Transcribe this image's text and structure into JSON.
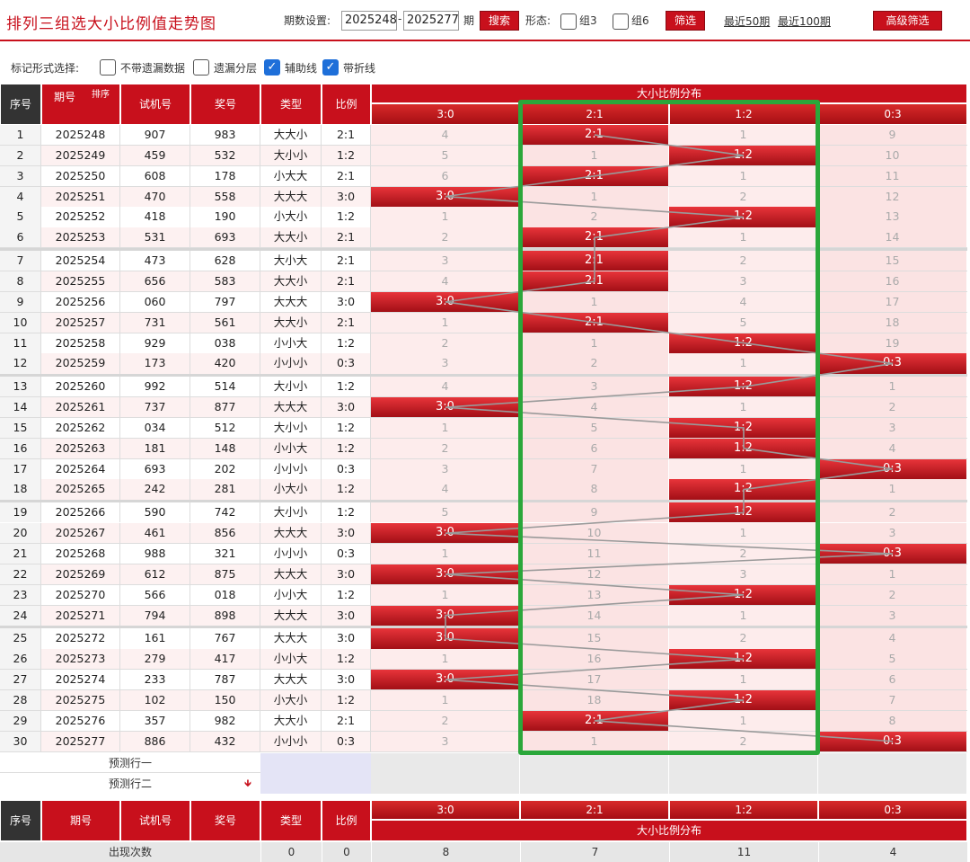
{
  "header": {
    "title": "排列三组选大小比例值走势图",
    "period_label": "期数设置:",
    "period_from": "2025248",
    "dash": "-",
    "period_to": "2025277",
    "period_unit": "期",
    "search_btn": "搜索",
    "form_label": "形态:",
    "group3": "组3",
    "group6": "组6",
    "filter_btn": "筛选",
    "recent50": "最近50期",
    "recent100": "最近100期",
    "advanced_btn": "高级筛选"
  },
  "options": {
    "label": "标记形式选择:",
    "items": [
      {
        "label": "不带遗漏数据",
        "checked": false
      },
      {
        "label": "遗漏分层",
        "checked": false
      },
      {
        "label": "辅助线",
        "checked": true
      },
      {
        "label": "带折线",
        "checked": true
      }
    ]
  },
  "table": {
    "headers": {
      "seq": "序号",
      "issue": "期号",
      "sort": "排序",
      "trial": "试机号",
      "award": "奖号",
      "type": "类型",
      "ratio": "比例",
      "dist": "大小比例分布"
    },
    "dist_columns": [
      "3:0",
      "2:1",
      "1:2",
      "0:3"
    ],
    "rows": [
      {
        "seq": "1",
        "issue": "2025248",
        "trial": "907",
        "award": "983",
        "type": "大大小",
        "ratio": "2:1",
        "cells": [
          "4",
          "2:1",
          "1",
          "9"
        ],
        "hit": 1
      },
      {
        "seq": "2",
        "issue": "2025249",
        "trial": "459",
        "award": "532",
        "type": "大小小",
        "ratio": "1:2",
        "cells": [
          "5",
          "1",
          "1:2",
          "10"
        ],
        "hit": 2
      },
      {
        "seq": "3",
        "issue": "2025250",
        "trial": "608",
        "award": "178",
        "type": "小大大",
        "ratio": "2:1",
        "cells": [
          "6",
          "2:1",
          "1",
          "11"
        ],
        "hit": 1
      },
      {
        "seq": "4",
        "issue": "2025251",
        "trial": "470",
        "award": "558",
        "type": "大大大",
        "ratio": "3:0",
        "cells": [
          "3:0",
          "1",
          "2",
          "12"
        ],
        "hit": 0
      },
      {
        "seq": "5",
        "issue": "2025252",
        "trial": "418",
        "award": "190",
        "type": "小大小",
        "ratio": "1:2",
        "cells": [
          "1",
          "2",
          "1:2",
          "13"
        ],
        "hit": 2
      },
      {
        "seq": "6",
        "issue": "2025253",
        "trial": "531",
        "award": "693",
        "type": "大大小",
        "ratio": "2:1",
        "cells": [
          "2",
          "2:1",
          "1",
          "14"
        ],
        "hit": 1
      },
      {
        "seq": "7",
        "issue": "2025254",
        "trial": "473",
        "award": "628",
        "type": "大小大",
        "ratio": "2:1",
        "cells": [
          "3",
          "2:1",
          "2",
          "15"
        ],
        "hit": 1
      },
      {
        "seq": "8",
        "issue": "2025255",
        "trial": "656",
        "award": "583",
        "type": "大大小",
        "ratio": "2:1",
        "cells": [
          "4",
          "2:1",
          "3",
          "16"
        ],
        "hit": 1
      },
      {
        "seq": "9",
        "issue": "2025256",
        "trial": "060",
        "award": "797",
        "type": "大大大",
        "ratio": "3:0",
        "cells": [
          "3:0",
          "1",
          "4",
          "17"
        ],
        "hit": 0
      },
      {
        "seq": "10",
        "issue": "2025257",
        "trial": "731",
        "award": "561",
        "type": "大大小",
        "ratio": "2:1",
        "cells": [
          "1",
          "2:1",
          "5",
          "18"
        ],
        "hit": 1
      },
      {
        "seq": "11",
        "issue": "2025258",
        "trial": "929",
        "award": "038",
        "type": "小小大",
        "ratio": "1:2",
        "cells": [
          "2",
          "1",
          "1:2",
          "19"
        ],
        "hit": 2
      },
      {
        "seq": "12",
        "issue": "2025259",
        "trial": "173",
        "award": "420",
        "type": "小小小",
        "ratio": "0:3",
        "cells": [
          "3",
          "2",
          "1",
          "0:3"
        ],
        "hit": 3
      },
      {
        "seq": "13",
        "issue": "2025260",
        "trial": "992",
        "award": "514",
        "type": "大小小",
        "ratio": "1:2",
        "cells": [
          "4",
          "3",
          "1:2",
          "1"
        ],
        "hit": 2
      },
      {
        "seq": "14",
        "issue": "2025261",
        "trial": "737",
        "award": "877",
        "type": "大大大",
        "ratio": "3:0",
        "cells": [
          "3:0",
          "4",
          "1",
          "2"
        ],
        "hit": 0
      },
      {
        "seq": "15",
        "issue": "2025262",
        "trial": "034",
        "award": "512",
        "type": "大小小",
        "ratio": "1:2",
        "cells": [
          "1",
          "5",
          "1:2",
          "3"
        ],
        "hit": 2
      },
      {
        "seq": "16",
        "issue": "2025263",
        "trial": "181",
        "award": "148",
        "type": "小小大",
        "ratio": "1:2",
        "cells": [
          "2",
          "6",
          "1:2",
          "4"
        ],
        "hit": 2
      },
      {
        "seq": "17",
        "issue": "2025264",
        "trial": "693",
        "award": "202",
        "type": "小小小",
        "ratio": "0:3",
        "cells": [
          "3",
          "7",
          "1",
          "0:3"
        ],
        "hit": 3
      },
      {
        "seq": "18",
        "issue": "2025265",
        "trial": "242",
        "award": "281",
        "type": "小大小",
        "ratio": "1:2",
        "cells": [
          "4",
          "8",
          "1:2",
          "1"
        ],
        "hit": 2
      },
      {
        "seq": "19",
        "issue": "2025266",
        "trial": "590",
        "award": "742",
        "type": "大小小",
        "ratio": "1:2",
        "cells": [
          "5",
          "9",
          "1:2",
          "2"
        ],
        "hit": 2
      },
      {
        "seq": "20",
        "issue": "2025267",
        "trial": "461",
        "award": "856",
        "type": "大大大",
        "ratio": "3:0",
        "cells": [
          "3:0",
          "10",
          "1",
          "3"
        ],
        "hit": 0
      },
      {
        "seq": "21",
        "issue": "2025268",
        "trial": "988",
        "award": "321",
        "type": "小小小",
        "ratio": "0:3",
        "cells": [
          "1",
          "11",
          "2",
          "0:3"
        ],
        "hit": 3
      },
      {
        "seq": "22",
        "issue": "2025269",
        "trial": "612",
        "award": "875",
        "type": "大大大",
        "ratio": "3:0",
        "cells": [
          "3:0",
          "12",
          "3",
          "1"
        ],
        "hit": 0
      },
      {
        "seq": "23",
        "issue": "2025270",
        "trial": "566",
        "award": "018",
        "type": "小小大",
        "ratio": "1:2",
        "cells": [
          "1",
          "13",
          "1:2",
          "2"
        ],
        "hit": 2
      },
      {
        "seq": "24",
        "issue": "2025271",
        "trial": "794",
        "award": "898",
        "type": "大大大",
        "ratio": "3:0",
        "cells": [
          "3:0",
          "14",
          "1",
          "3"
        ],
        "hit": 0
      },
      {
        "seq": "25",
        "issue": "2025272",
        "trial": "161",
        "award": "767",
        "type": "大大大",
        "ratio": "3:0",
        "cells": [
          "3:0",
          "15",
          "2",
          "4"
        ],
        "hit": 0
      },
      {
        "seq": "26",
        "issue": "2025273",
        "trial": "279",
        "award": "417",
        "type": "小小大",
        "ratio": "1:2",
        "cells": [
          "1",
          "16",
          "1:2",
          "5"
        ],
        "hit": 2
      },
      {
        "seq": "27",
        "issue": "2025274",
        "trial": "233",
        "award": "787",
        "type": "大大大",
        "ratio": "3:0",
        "cells": [
          "3:0",
          "17",
          "1",
          "6"
        ],
        "hit": 0
      },
      {
        "seq": "28",
        "issue": "2025275",
        "trial": "102",
        "award": "150",
        "type": "小大小",
        "ratio": "1:2",
        "cells": [
          "1",
          "18",
          "1:2",
          "7"
        ],
        "hit": 2
      },
      {
        "seq": "29",
        "issue": "2025276",
        "trial": "357",
        "award": "982",
        "type": "大大小",
        "ratio": "2:1",
        "cells": [
          "2",
          "2:1",
          "1",
          "8"
        ],
        "hit": 1
      },
      {
        "seq": "30",
        "issue": "2025277",
        "trial": "886",
        "award": "432",
        "type": "小小小",
        "ratio": "0:3",
        "cells": [
          "3",
          "1",
          "2",
          "0:3"
        ],
        "hit": 3
      }
    ],
    "predict1": "预测行一",
    "predict2": "预测行二",
    "predict_arrow": "🡻",
    "stats_label": "出现次数",
    "stats": [
      "0",
      "0",
      "8",
      "7",
      "11",
      "4"
    ]
  },
  "colors": {
    "brand": "#c8101c",
    "highlight_box": "#2aa73a"
  }
}
